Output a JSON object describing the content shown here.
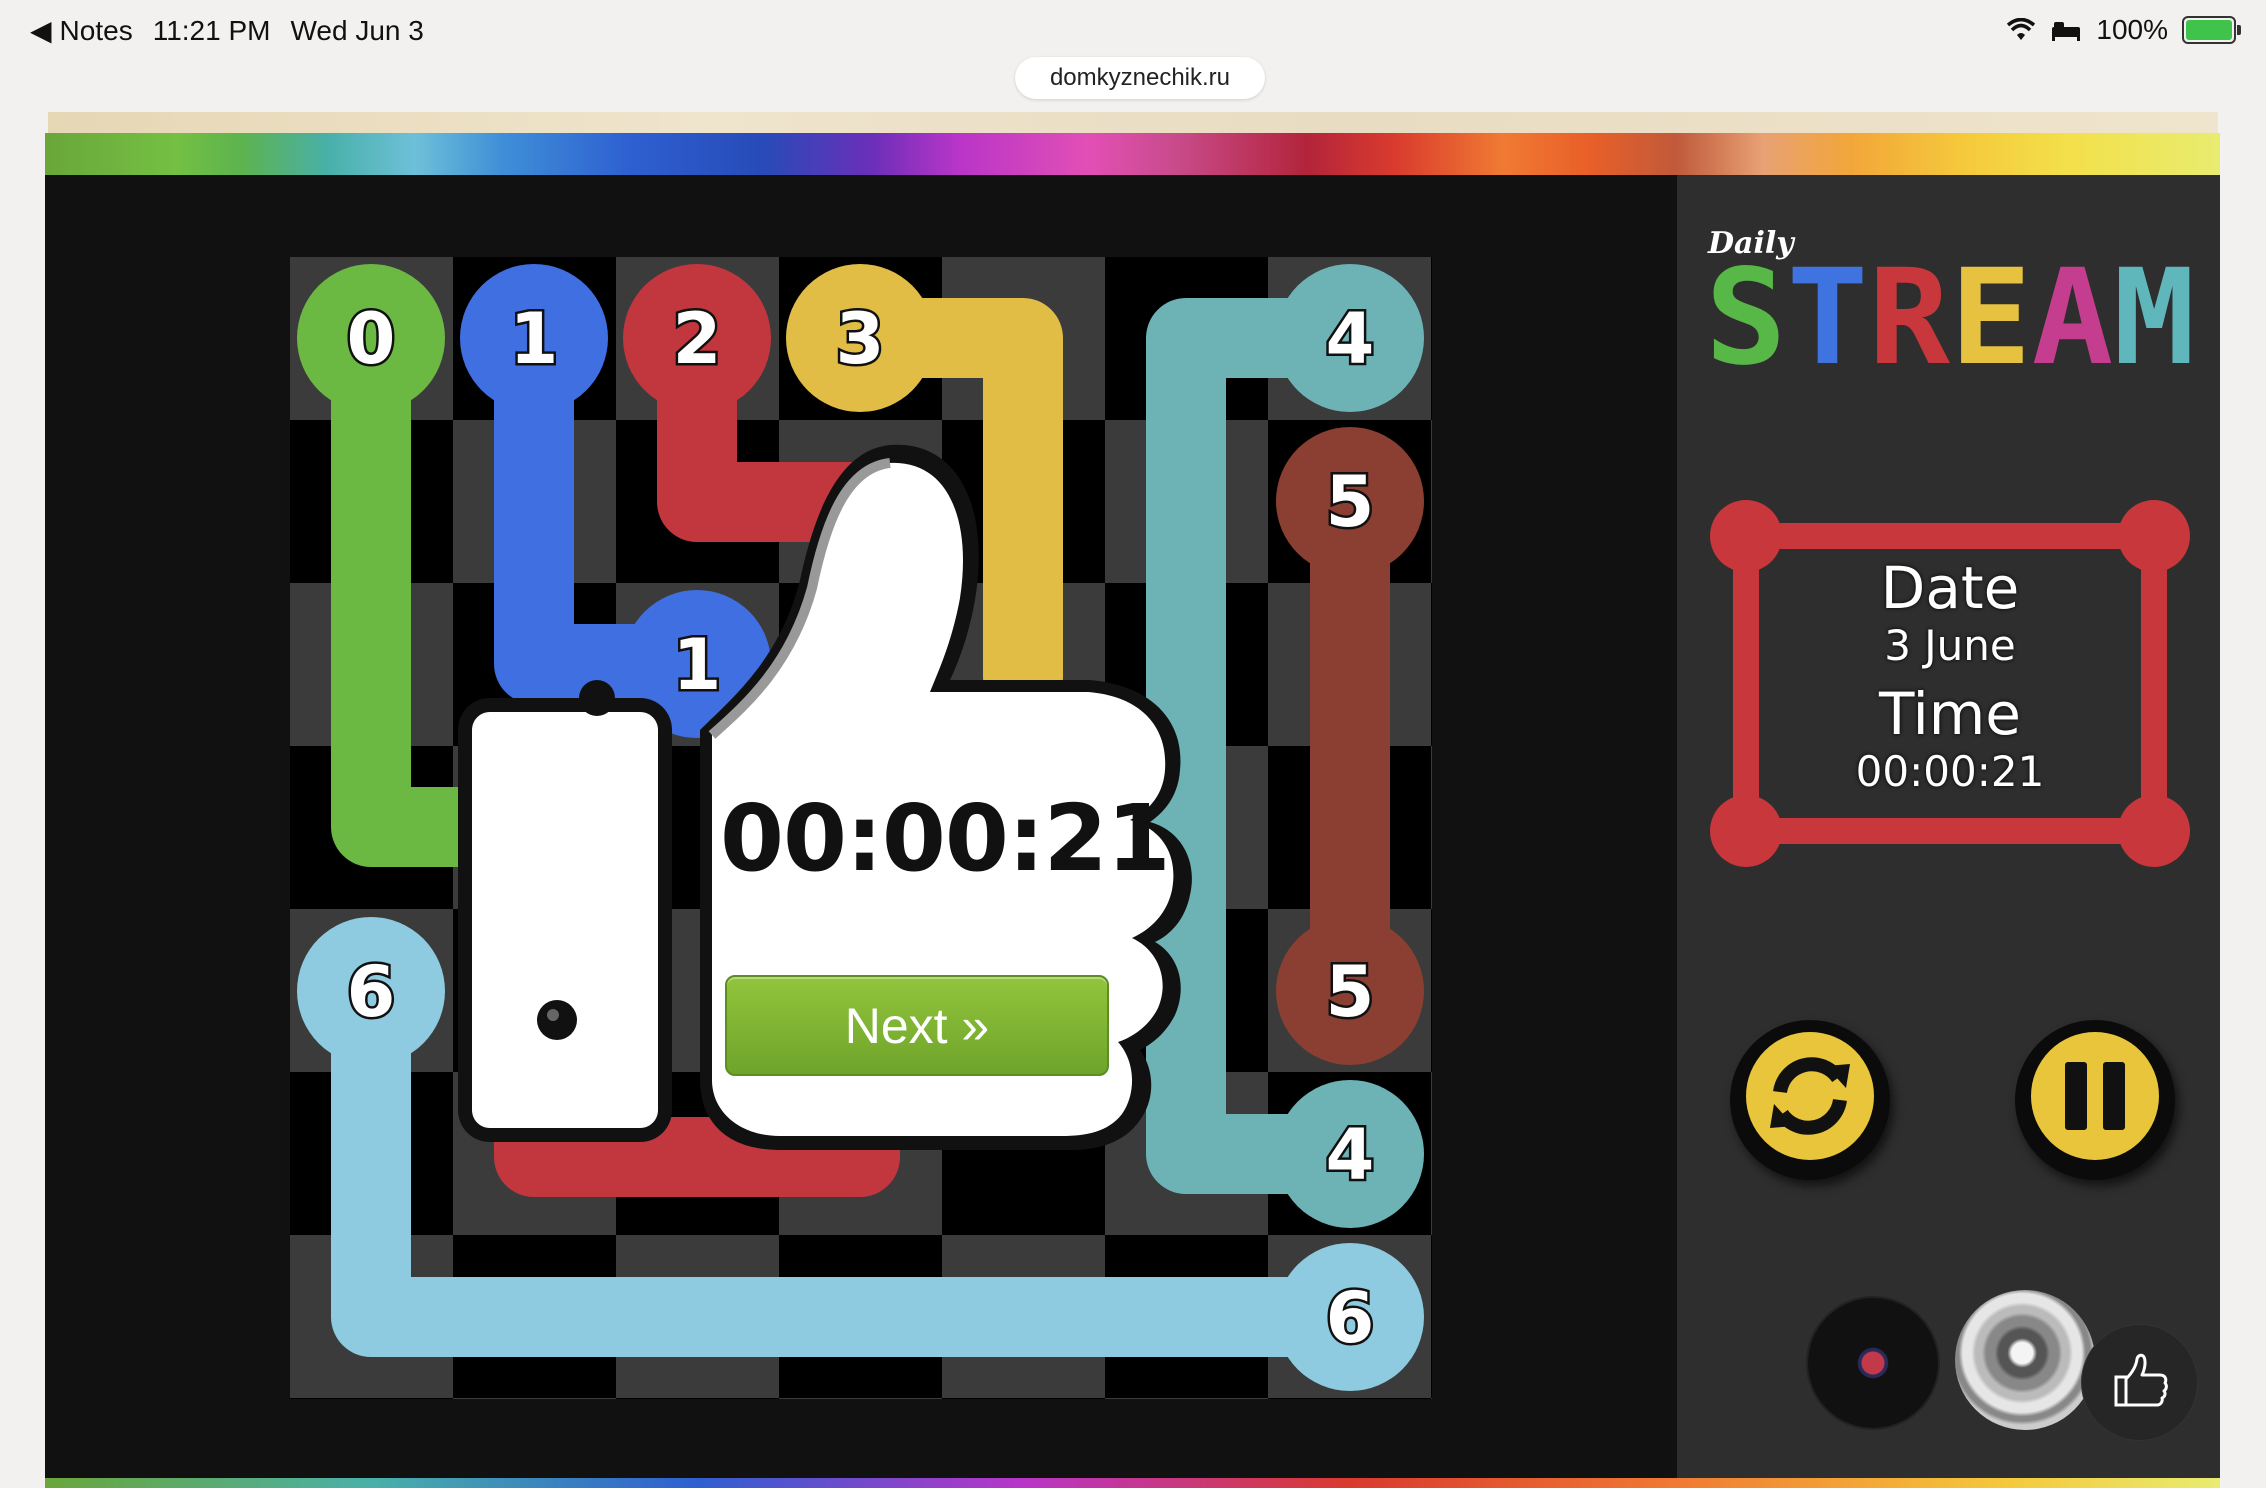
{
  "status_bar": {
    "back_label": "Notes",
    "time": "11:21 PM",
    "date": "Wed Jun 3",
    "battery": "100%"
  },
  "browser": {
    "url": "domkyznechik.ru"
  },
  "game": {
    "title_small": "Daily",
    "title_big": "STREAM",
    "title_letter_colors": [
      "#57b847",
      "#3f74e0",
      "#c8373c",
      "#e6c240",
      "#c43d8e",
      "#5fb7bc"
    ],
    "grid_size": 7,
    "endpoint_labels": {
      "green_top": "0",
      "blue_top": "1",
      "red_top": "2",
      "yellow_top": "3",
      "teal_top": "4",
      "brown_top": "5",
      "blue_bottom": "1",
      "lightblue_left": "6",
      "brown_bottom": "5",
      "teal_bottom": "4",
      "lightblue_right": "6"
    },
    "pipe_colors": {
      "0": "#6bb842",
      "1": "#3f6fe0",
      "2": "#c2363e",
      "3": "#e2bd45",
      "4": "#6db3b5",
      "5": "#8a3f32",
      "6": "#8ecae0"
    }
  },
  "win_overlay": {
    "elapsed": "00:00:21",
    "next_label": "Next »"
  },
  "info": {
    "date_label": "Date",
    "date_value": "3 June",
    "time_label": "Time",
    "time_value": "00:00:21",
    "frame_color": "#c8373c"
  },
  "controls": {
    "restart_icon": "restart-icon",
    "pause_icon": "pause-icon",
    "music_icon": "music-record-icon",
    "sound_icon": "speaker-icon",
    "like_icon": "thumbs-up-icon"
  }
}
